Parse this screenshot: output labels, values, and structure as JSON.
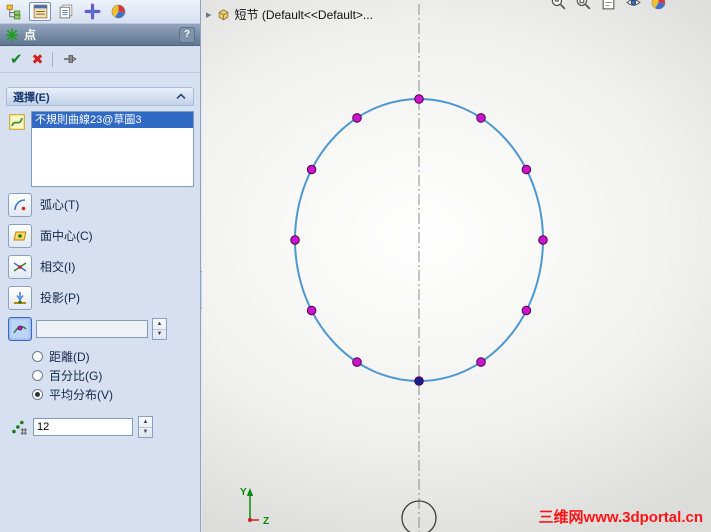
{
  "panel": {
    "tabs": [
      {
        "name": "feature-manager"
      },
      {
        "name": "property-manager"
      },
      {
        "name": "configuration-manager"
      },
      {
        "name": "dimxpert-manager"
      },
      {
        "name": "display-manager"
      }
    ],
    "title": "点",
    "help_label": "?",
    "group_header": "選擇(E)",
    "selection_items": [
      "不規則曲線23@草圖3"
    ],
    "options": [
      {
        "label": "弧心(T)"
      },
      {
        "label": "面中心(C)"
      },
      {
        "label": "相交(I)"
      },
      {
        "label": "投影(P)"
      }
    ],
    "reference_value": "",
    "radios": [
      {
        "label": "距離(D)",
        "selected": false
      },
      {
        "label": "百分比(G)",
        "selected": false
      },
      {
        "label": "平均分布(V)",
        "selected": true
      }
    ],
    "count_value": "12"
  },
  "graphics": {
    "doc_title": "短节 (Default<<Default>...",
    "points": {
      "count": 12,
      "color": "#cc14cc",
      "bottom_color": "#1c1c8e"
    },
    "axis_labels": {
      "y": "Y",
      "z": "Z"
    },
    "watermark": "三维网www.3dportal.cn"
  },
  "icons": {
    "ok_glyph": "✔",
    "cancel_glyph": "✖",
    "spinner_up": "▲",
    "spinner_down": "▼",
    "flyout_arrow": "▸"
  },
  "colors": {
    "selection_highlight": "#316ac5",
    "spline": "#4e97cf",
    "watermark_red": "#ff1414"
  }
}
